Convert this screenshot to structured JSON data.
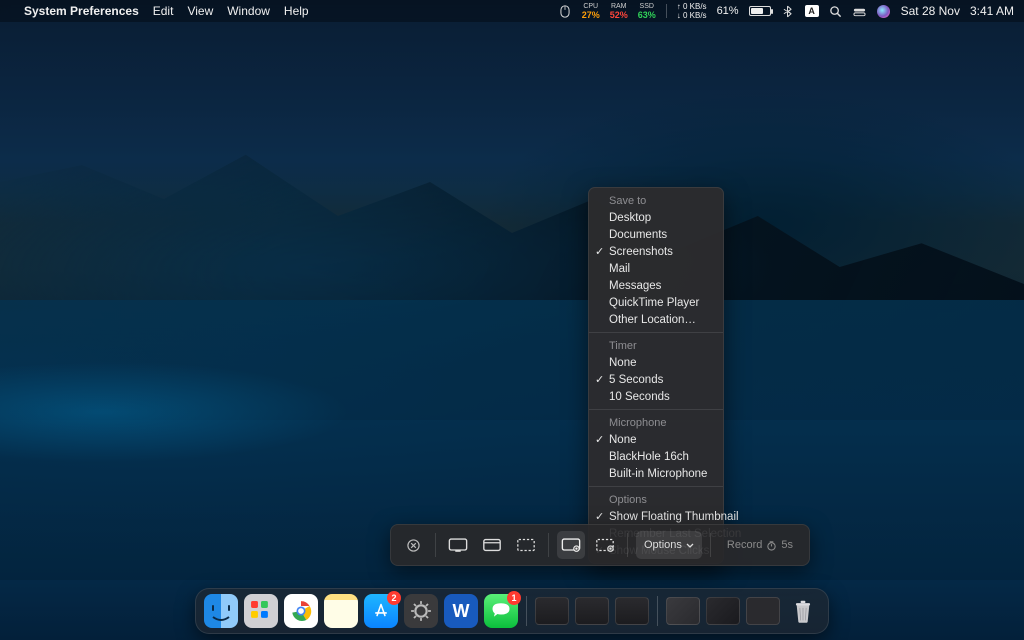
{
  "menubar": {
    "app_name": "System Preferences",
    "menus": [
      "Edit",
      "View",
      "Window",
      "Help"
    ],
    "stats": {
      "cpu": {
        "label": "CPU",
        "value": "27%",
        "color": "#ff9f0a"
      },
      "ram": {
        "label": "RAM",
        "value": "52%",
        "color": "#ff453a"
      },
      "ssd": {
        "label": "SSD",
        "value": "63%",
        "color": "#30d158"
      }
    },
    "network": {
      "up": "0 KB/s",
      "down": "0 KB/s"
    },
    "battery": {
      "percent_text": "61%",
      "fill_pct": 61
    },
    "datetime": {
      "date": "Sat 28 Nov",
      "time": "3:41 AM"
    }
  },
  "screenshot_toolbar": {
    "options_label": "Options",
    "record_label": "Record",
    "record_timer": "5s"
  },
  "options_menu": {
    "sections": [
      {
        "title": "Save to",
        "items": [
          {
            "label": "Desktop",
            "checked": false
          },
          {
            "label": "Documents",
            "checked": false
          },
          {
            "label": "Screenshots",
            "checked": true
          },
          {
            "label": "Mail",
            "checked": false
          },
          {
            "label": "Messages",
            "checked": false
          },
          {
            "label": "QuickTime Player",
            "checked": false
          },
          {
            "label": "Other Location…",
            "checked": false
          }
        ]
      },
      {
        "title": "Timer",
        "items": [
          {
            "label": "None",
            "checked": false
          },
          {
            "label": "5 Seconds",
            "checked": true
          },
          {
            "label": "10 Seconds",
            "checked": false
          }
        ]
      },
      {
        "title": "Microphone",
        "items": [
          {
            "label": "None",
            "checked": true
          },
          {
            "label": "BlackHole 16ch",
            "checked": false
          },
          {
            "label": "Built-in Microphone",
            "checked": false
          }
        ]
      },
      {
        "title": "Options",
        "items": [
          {
            "label": "Show Floating Thumbnail",
            "checked": true
          },
          {
            "label": "Remember Last Selection",
            "checked": false
          },
          {
            "label": "Show Mouse Clicks",
            "checked": true
          }
        ]
      }
    ]
  },
  "dock": {
    "badges": {
      "app_store": "2",
      "messages": "1"
    }
  }
}
